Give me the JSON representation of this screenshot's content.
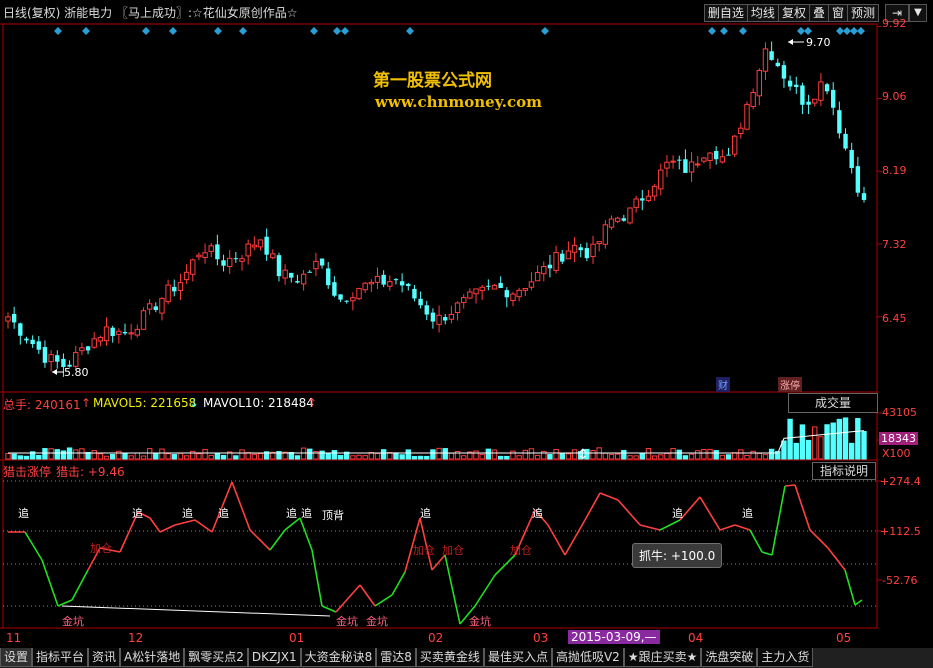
{
  "header": {
    "title": "日线(复权) 浙能电力 〖马上成功〗:☆花仙女原创作品☆",
    "buttons": [
      "删自选",
      "均线",
      "复权",
      "叠",
      "窗",
      "预测"
    ],
    "nav_arrow": "⇥",
    "menu_arrow": "▼"
  },
  "watermark": {
    "line1": "第一股票公式网",
    "line2": "www.chnmoney.com"
  },
  "price_panel": {
    "y_ticks": [
      "9.92",
      "9.06",
      "8.19",
      "7.32",
      "6.45"
    ],
    "high_marker": "9.70",
    "low_marker": "5.80",
    "event_tags": [
      "财",
      "涨停"
    ],
    "colors": {
      "up": "#ff3c3c",
      "down": "#54ffff",
      "diamond": "#2a9fd6",
      "axis": "#b00000"
    }
  },
  "volume_panel": {
    "label_total": "总手: 240161",
    "label_ma5": "MAVOL5: 221658",
    "label_ma10": "MAVOL10: 218484",
    "dropdown": "成交量",
    "y_ticks": [
      "43105",
      "18343"
    ],
    "unit": "X100"
  },
  "indicator_panel": {
    "label_name": "猎击涨停",
    "label_value": "猎击: +9.46",
    "help_button": "指标说明",
    "y_ticks": [
      "+274.4",
      "+112.5",
      "-52.76"
    ],
    "signals_zhui": [
      "追",
      "追",
      "追",
      "追",
      "追",
      "追",
      "追",
      "追",
      "追",
      "追"
    ],
    "signal_dingbei": "顶背",
    "signals_jiacang": [
      "加仓",
      "加仓",
      "加仓",
      "加仓"
    ],
    "signals_jinkeng": [
      "金坑",
      "金坑",
      "金坑",
      "金坑"
    ],
    "tooltip": "抓牛: +100.0"
  },
  "time_axis": {
    "labels": [
      "11",
      "12",
      "01",
      "02",
      "03",
      "04",
      "05"
    ],
    "selected_date": "2015-03-09,—"
  },
  "tabs": [
    "设置",
    "指标平台",
    "资讯",
    "A松针落地",
    "飘零买点2",
    "DKZJX1",
    "大资金秘诀8",
    "雷达8",
    "买卖黄金线",
    "最佳买入点",
    "高抛低吸V2",
    "★跟庄买卖★",
    "洗盘突破",
    "主力入货"
  ],
  "chart_data": {
    "type": "candlestick",
    "title": "浙能电力",
    "period": "daily",
    "price_ylim": [
      5.8,
      9.92
    ],
    "labeled_high": 9.7,
    "labeled_low": 5.8,
    "x_months": [
      "11",
      "12",
      "01",
      "02",
      "03",
      "04",
      "05"
    ],
    "close_path": [
      6.45,
      6.2,
      5.95,
      5.85,
      6.1,
      6.3,
      6.25,
      6.45,
      6.7,
      6.9,
      7.3,
      7.1,
      7.2,
      7.4,
      6.95,
      6.9,
      7.1,
      6.65,
      6.8,
      6.85,
      6.9,
      6.65,
      6.4,
      6.55,
      6.7,
      6.8,
      6.75,
      6.9,
      7.1,
      7.3,
      7.2,
      7.6,
      7.7,
      8.0,
      8.3,
      8.2,
      8.5,
      8.3,
      9.0,
      9.7,
      9.3,
      9.0,
      9.3,
      8.5,
      7.8
    ],
    "volume_ylim": [
      0,
      43105
    ],
    "volume_total": 240161,
    "mavol5": 221658,
    "mavol10": 218484,
    "indicator_ylim": [
      -120,
      274.4
    ],
    "indicator_current": 9.46,
    "indicator_ref_lines": [
      274.4,
      112.5,
      -52.76
    ]
  }
}
